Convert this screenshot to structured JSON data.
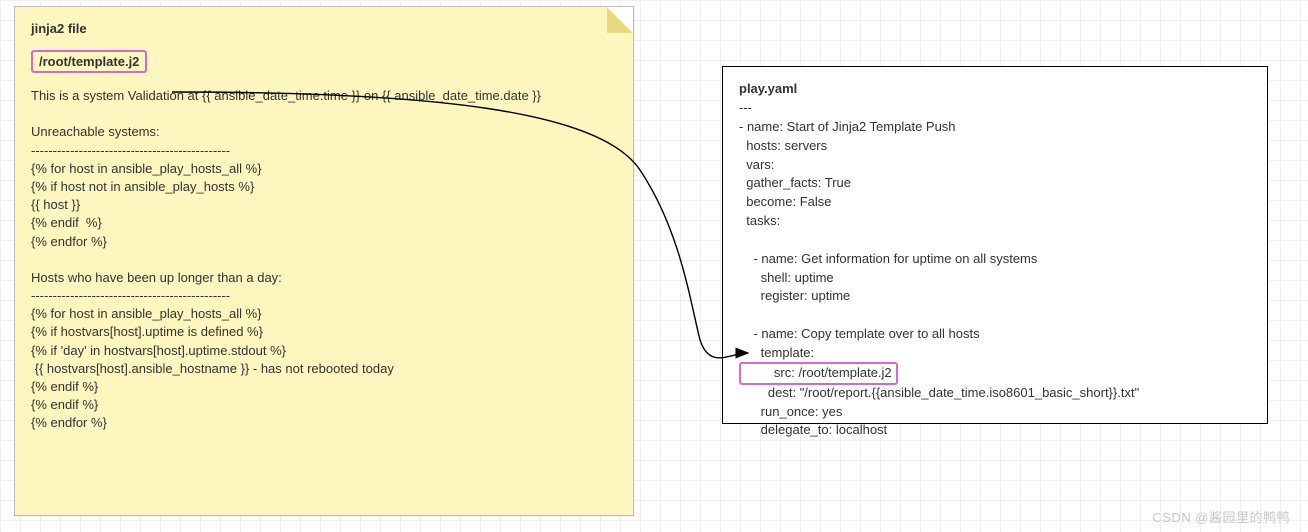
{
  "left": {
    "title": "jinja2 file",
    "path": "/root/template.j2",
    "body": "This is a system Validation at {{ ansible_date_time.time }} on {{ ansible_date_time.date }}\n\nUnreachable systems:\n----------------------------------------------\n{% for host in ansible_play_hosts_all %}\n{% if host not in ansible_play_hosts %}\n{{ host }}\n{% endif  %}\n{% endfor %}\n\nHosts who have been up longer than a day:\n----------------------------------------------\n{% for host in ansible_play_hosts_all %}\n{% if hostvars[host].uptime is defined %}\n{% if 'day' in hostvars[host].uptime.stdout %}\n {{ hostvars[host].ansible_hostname }} - has not rebooted today\n{% endif %}\n{% endif %}\n{% endfor %}"
  },
  "right": {
    "title": "play.yaml",
    "pre": "---\n- name: Start of Jinja2 Template Push\n  hosts: servers\n  vars:\n  gather_facts: True\n  become: False\n  tasks:\n\n    - name: Get information for uptime on all systems\n      shell: uptime\n      register: uptime\n\n    - name: Copy template over to all hosts\n      template:",
    "src_line": "        src: /root/template.j2",
    "post": "        dest: \"/root/report.{{ansible_date_time.iso8601_basic_short}}.txt\"\n      run_once: yes\n      delegate_to: localhost"
  },
  "watermark": "CSDN @酱园里的鸭鸭"
}
